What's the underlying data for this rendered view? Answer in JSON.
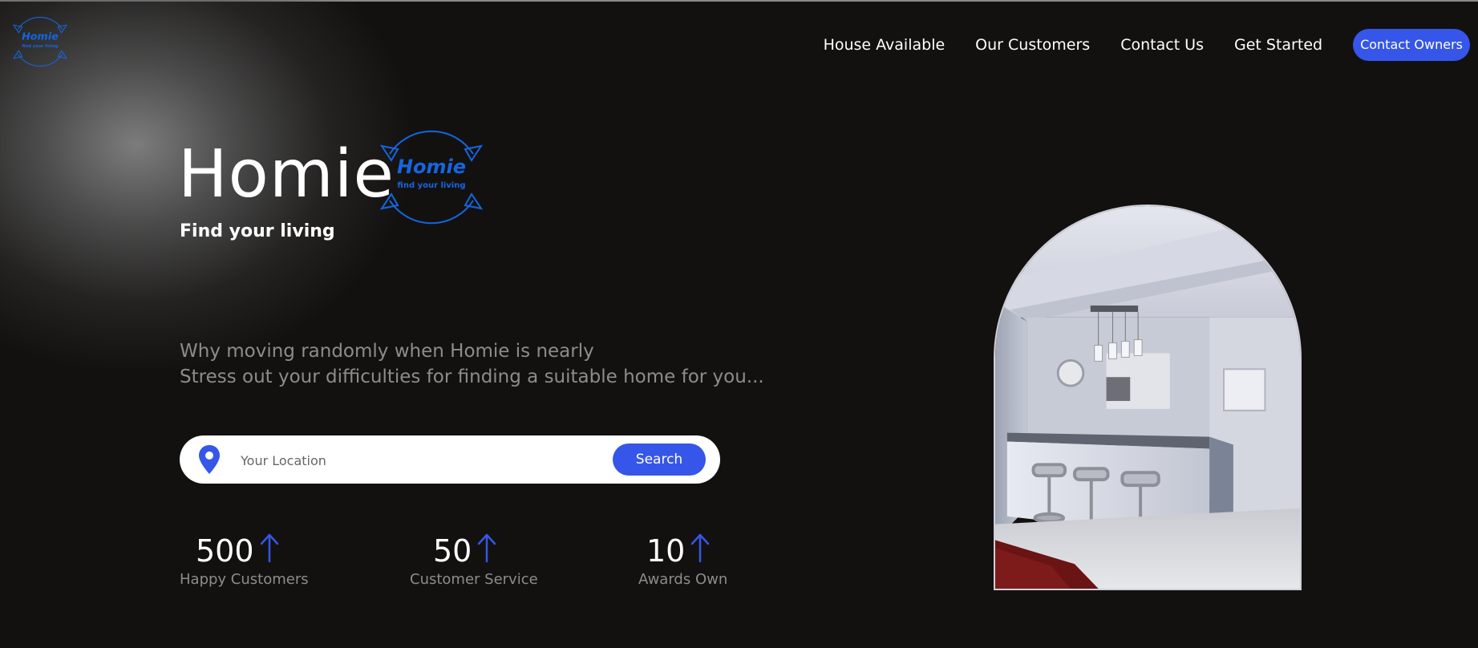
{
  "brand": {
    "logo_word": "Homie",
    "logo_sub": "find your living"
  },
  "nav": {
    "items": [
      {
        "label": "House Available"
      },
      {
        "label": "Our Customers"
      },
      {
        "label": "Contact Us"
      },
      {
        "label": "Get Started"
      }
    ],
    "cta_label": "Contact Owners"
  },
  "hero": {
    "title": "Homie",
    "tagline": "Find your living",
    "desc_line1": "Why moving randomly when Homie is nearly",
    "desc_line2": "Stress out your difficulties for finding a suitable home for you..."
  },
  "search": {
    "placeholder": "Your Location",
    "value": "",
    "button_label": "Search",
    "pin_icon": "location-pin-icon"
  },
  "stats": [
    {
      "number": "500",
      "label": "Happy Customers",
      "icon": "arrow-up-icon"
    },
    {
      "number": "50",
      "label": "Customer Service",
      "icon": "arrow-up-icon"
    },
    {
      "number": "10",
      "label": "Awards Own",
      "icon": "arrow-up-icon"
    }
  ],
  "colors": {
    "background": "#131110",
    "accent": "#3556e8",
    "logo_blue": "#1565e0",
    "muted_text": "#8c8c8c"
  }
}
